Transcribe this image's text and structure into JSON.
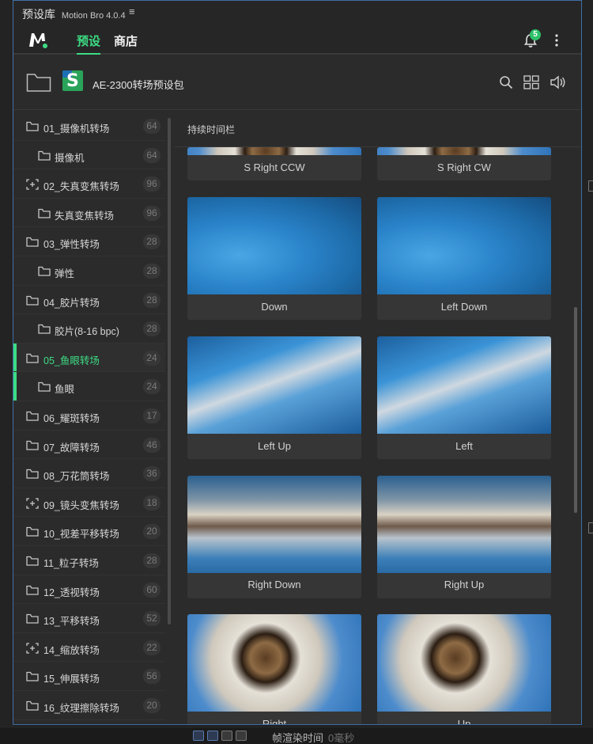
{
  "titlebar": {
    "title": "预设库",
    "version": "Motion Bro 4.0.4",
    "menu_glyph": "≡"
  },
  "nav": {
    "tab_presets": "预设",
    "tab_store": "商店",
    "notification_count": "5"
  },
  "pack": {
    "title": "AE-2300转场预设包",
    "logo_letter": "S"
  },
  "categories": [
    {
      "label": "01_摄像机转场",
      "count": "64",
      "icon": "folder-icon"
    },
    {
      "label": "摄像机",
      "count": "64",
      "icon": "folder-icon"
    },
    {
      "label": "02_失真变焦转场",
      "count": "96",
      "icon": "zoom-frame-icon"
    },
    {
      "label": "失真变焦转场",
      "count": "96",
      "icon": "folder-icon"
    },
    {
      "label": "03_弹性转场",
      "count": "28",
      "icon": "folder-icon"
    },
    {
      "label": "弹性",
      "count": "28",
      "icon": "folder-icon"
    },
    {
      "label": "04_胶片转场",
      "count": "28",
      "icon": "folder-icon"
    },
    {
      "label": "胶片(8-16 bpc)",
      "count": "28",
      "icon": "folder-icon"
    },
    {
      "label": "05_鱼眼转场",
      "count": "24",
      "icon": "folder-icon"
    },
    {
      "label": "鱼眼",
      "count": "24",
      "icon": "folder-icon"
    },
    {
      "label": "06_耀斑转场",
      "count": "17",
      "icon": "folder-icon"
    },
    {
      "label": "07_故障转场",
      "count": "46",
      "icon": "folder-icon"
    },
    {
      "label": "08_万花筒转场",
      "count": "36",
      "icon": "folder-icon"
    },
    {
      "label": "09_镜头变焦转场",
      "count": "18",
      "icon": "zoom-frame-icon"
    },
    {
      "label": "10_视差平移转场",
      "count": "20",
      "icon": "folder-icon"
    },
    {
      "label": "11_粒子转场",
      "count": "28",
      "icon": "folder-icon"
    },
    {
      "label": "12_透视转场",
      "count": "60",
      "icon": "folder-icon"
    },
    {
      "label": "13_平移转场",
      "count": "52",
      "icon": "folder-icon"
    },
    {
      "label": "14_缩放转场",
      "count": "22",
      "icon": "zoom-frame-icon"
    },
    {
      "label": "15_伸展转场",
      "count": "56",
      "icon": "folder-icon"
    },
    {
      "label": "16_纹理擦除转场",
      "count": "20",
      "icon": "folder-icon"
    }
  ],
  "content": {
    "header": "持续时间栏",
    "presets": [
      {
        "label": "S Right CCW"
      },
      {
        "label": "S Right CW"
      },
      {
        "label": "Down"
      },
      {
        "label": "Left Down"
      },
      {
        "label": "Left Up"
      },
      {
        "label": "Left"
      },
      {
        "label": "Right Down"
      },
      {
        "label": "Right Up"
      },
      {
        "label": "Right"
      },
      {
        "label": "Up"
      }
    ]
  },
  "host": {
    "status_label": "帧渲染时间",
    "status_value": "0毫秒"
  },
  "colors": {
    "accent": "#3ddc84",
    "panel_border": "#3f6fa7",
    "badge": "#2ec16a"
  }
}
